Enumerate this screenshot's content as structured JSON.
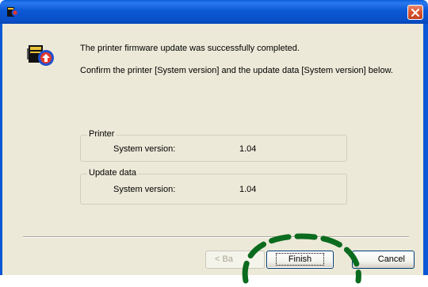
{
  "window": {
    "close_icon": "close-icon"
  },
  "dialog": {
    "icon": "printer-firmware-icon",
    "message_line1": "The printer firmware update was successfully completed.",
    "message_line2": "Confirm the printer [System version] and the update data [System version] below."
  },
  "groups": {
    "printer": {
      "legend": "Printer",
      "label": "System version:",
      "value": "1.04"
    },
    "update_data": {
      "legend": "Update data",
      "label": "System version:",
      "value": "1.04"
    }
  },
  "buttons": {
    "back_label": "< Ba",
    "finish_label": "Finish",
    "cancel_label": "Cancel"
  },
  "colors": {
    "titlebar": "#0b58d6",
    "dialog_bg": "#ece9d8",
    "close": "#d9542d",
    "highlight": "#0b6b1e"
  }
}
